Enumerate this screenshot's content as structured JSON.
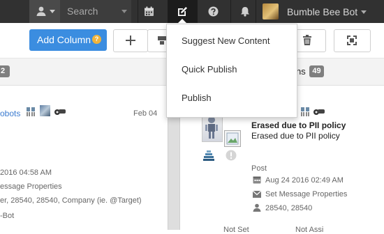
{
  "topbar": {
    "search_label": "Search",
    "user_name": "Bumble Bee Bot"
  },
  "toolbar": {
    "add_column_label": "Add Column",
    "add_column_badge": "?"
  },
  "publish_menu": {
    "items": [
      {
        "label": "Suggest New Content"
      },
      {
        "label": "Quick Publish"
      },
      {
        "label": "Publish"
      }
    ]
  },
  "left_column": {
    "count": "2",
    "item": {
      "author": "obots",
      "date": "Feb 04",
      "timestamp": "2016 04:58 AM",
      "link": "essage Properties",
      "targets": "er, 28540, 28540, Company (ie. @Target)",
      "signature": "-Bot"
    }
  },
  "right_column": {
    "title_fragment": "ns",
    "count": "49",
    "item": {
      "title": "Erased due to PII policy",
      "body": "Erased due to PII policy",
      "type": "Post",
      "timestamp": "Aug 24 2016 02:49 AM",
      "link": "Set Message Properties",
      "targets": "28540, 28540",
      "footer_left": "Not Set",
      "footer_right": "Not Assi"
    }
  },
  "colors": {
    "topbar_bg": "#313131",
    "accent_blue": "#3b8de0",
    "badge_orange": "#f0b33a"
  }
}
